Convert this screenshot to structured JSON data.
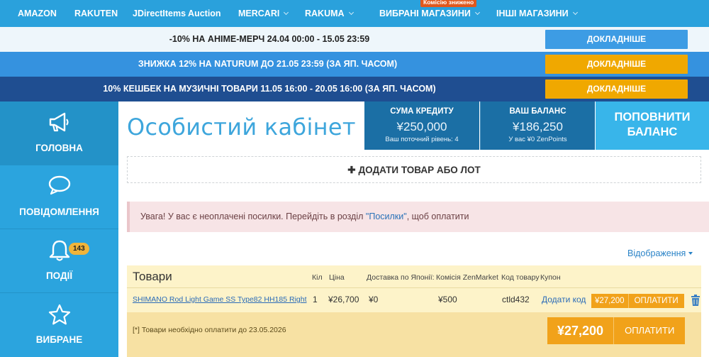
{
  "nav": {
    "items": [
      {
        "label": "AMAZON",
        "dropdown": false
      },
      {
        "label": "RAKUTEN",
        "dropdown": false
      },
      {
        "label": "JDirectItems Auction",
        "dropdown": false
      },
      {
        "label": "MERCARI",
        "dropdown": true
      },
      {
        "label": "RAKUMA",
        "dropdown": true
      },
      {
        "label": "ВИБРАНІ МАГАЗИНИ",
        "dropdown": true
      },
      {
        "label": "ІНШІ МАГАЗИНИ",
        "dropdown": true
      }
    ],
    "badge": "Комісію знижено"
  },
  "promos": [
    {
      "text": "-10% НА АНІМЕ-МЕРЧ 24.04 00:00 - 15.05 23:59",
      "button": "ДОКЛАДНІШЕ"
    },
    {
      "text": "ЗНИЖКА 12% НА NATURUM ДО 21.05 23:59 (ЗА ЯП. ЧАСОМ)",
      "button": "ДОКЛАДНІШЕ"
    },
    {
      "text": "10% КЕШБЕК НА МУЗИЧНІ ТОВАРИ 11.05 16:00 - 20.05 16:00 (ЗА ЯП. ЧАСОМ)",
      "button": "ДОКЛАДНІШЕ"
    }
  ],
  "sidebar": {
    "items": [
      {
        "label": "ГОЛОВНА",
        "icon": "megaphone-icon",
        "active": true
      },
      {
        "label": "ПОВІДОМЛЕННЯ",
        "icon": "chat-bubble-icon",
        "active": false
      },
      {
        "label": "ПОДІЇ",
        "icon": "bell-icon",
        "active": false,
        "badge": "143"
      },
      {
        "label": "ВИБРАНЕ",
        "icon": "star-icon",
        "active": false
      }
    ]
  },
  "header": {
    "title": "Особистий кабінет",
    "credit": {
      "label": "СУМА КРЕДИТУ",
      "value": "¥250,000",
      "sub": "Ваш поточний рівень: 4"
    },
    "balance": {
      "label": "ВАШ БАЛАНС",
      "value": "¥186,250",
      "sub": "У вас ¥0 ZenPoints"
    },
    "topup_line1": "ПОПОВНИТИ",
    "topup_line2": "БАЛАНС"
  },
  "add_item": "ДОДАТИ ТОВАР АБО ЛОТ",
  "alert": {
    "prefix": "Увага! У вас є неоплачені посилки. Перейдіть в розділ ",
    "link": "\"Посилки\"",
    "suffix": ", щоб оплатити"
  },
  "view_toggle": "Відображення",
  "items_table": {
    "title": "Товари",
    "columns": {
      "qty": "Кіл",
      "price": "Ціна",
      "shipping": "Доставка по Японії:",
      "commission": "Комісія ZenMarket",
      "code": "Код товару",
      "coupon": "Купон"
    },
    "rows": [
      {
        "name": "SHIMANO Rod Light Game SS Type82 HH185 Right",
        "qty": "1",
        "price": "¥26,700",
        "shipping": "¥0",
        "commission": "¥500",
        "code": "ctld432",
        "coupon": "Додати код",
        "total": "¥27,200",
        "pay": "ОПЛАТИТИ"
      }
    ],
    "note": "[*] Товари необхідно оплатити до 23.05.2026",
    "grand_total": "¥27,200",
    "grand_pay": "ОПЛАТИТИ"
  },
  "colors": {
    "nav": "#2aa1dc",
    "sidebar": "#2ba4de",
    "stat_box": "#1b6fa5",
    "accent_orange": "#f1a21a",
    "title_blue": "#3ea6dc"
  }
}
